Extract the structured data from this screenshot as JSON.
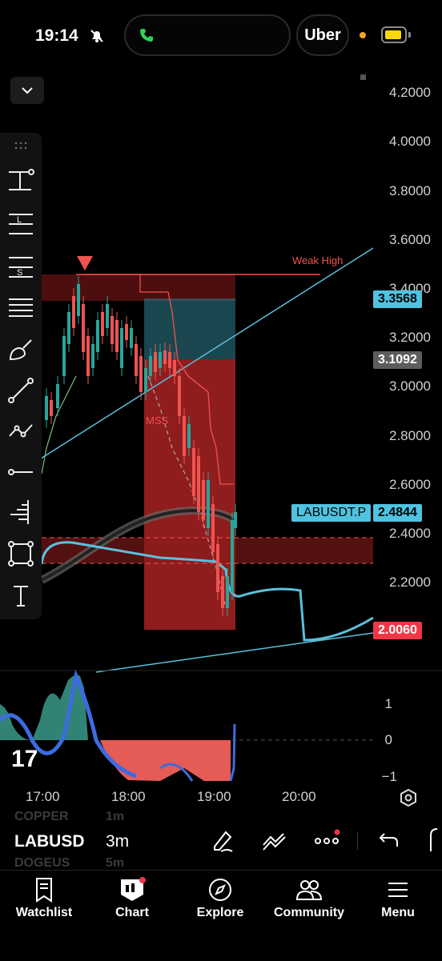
{
  "status_bar": {
    "time": "19:14",
    "uber": "Uber"
  },
  "price_axis": [
    "4.2000",
    "4.0000",
    "3.8000",
    "3.6000",
    "3.4000",
    "3.2000",
    "3.0000",
    "2.8000",
    "2.6000",
    "2.4000",
    "2.2000"
  ],
  "price_tags": {
    "upper_target": "3.3568",
    "entry": "3.1092",
    "symbol": "LABUSDT.P",
    "last_price": "2.4844",
    "stop": "2.0060"
  },
  "annotations": {
    "weak_high": "Weak High",
    "mss": "MSS"
  },
  "oscillator_axis": [
    "1",
    "0",
    "−1"
  ],
  "time_axis": [
    "17:00",
    "18:00",
    "19:00",
    "20:00"
  ],
  "symbol_picker": {
    "prev_symbol": "COPPER",
    "current_symbol": "LABUSD",
    "next_symbol": "DOGEUS",
    "prev_interval": "1m",
    "current_interval": "3m",
    "next_interval": "5m"
  },
  "tabs": [
    {
      "label": "Watchlist",
      "icon": "bookmark-icon"
    },
    {
      "label": "Chart",
      "icon": "chart-icon"
    },
    {
      "label": "Explore",
      "icon": "compass-icon"
    },
    {
      "label": "Community",
      "icon": "people-icon"
    },
    {
      "label": "Menu",
      "icon": "hamburger-icon"
    }
  ],
  "colors": {
    "up": "#26a69a",
    "down": "#ef5350",
    "accent_cyan": "#5bc0de",
    "tag_cyan": "#4fc3e0",
    "tag_red": "#f23645",
    "tag_gray": "#5d5d5d"
  }
}
